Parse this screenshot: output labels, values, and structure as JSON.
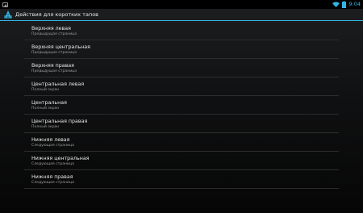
{
  "status_bar": {
    "notification_icon": "image-notification-icon",
    "time": "9:04",
    "wifi_icon": "wifi-icon",
    "battery_icon": "battery-icon",
    "accent_color": "#33b5e5"
  },
  "action_bar": {
    "app_icon": "app-logo-icon",
    "title": "Действия для коротких тапов"
  },
  "list": {
    "items": [
      {
        "title": "Верхняя левая",
        "summary": "Предыдущая страница"
      },
      {
        "title": "Верхняя центральная",
        "summary": "Предыдущая страница"
      },
      {
        "title": "Верхняя правая",
        "summary": "Предыдущая страница"
      },
      {
        "title": "Центральная левая",
        "summary": "Полный экран"
      },
      {
        "title": "Центральная",
        "summary": "Полный экран"
      },
      {
        "title": "Центральная правая",
        "summary": "Полный экран"
      },
      {
        "title": "Нижняя левая",
        "summary": "Следующая страница"
      },
      {
        "title": "Нижняя центральная",
        "summary": "Следующая страница"
      },
      {
        "title": "Нижняя правая",
        "summary": "Следующая страница"
      }
    ]
  }
}
